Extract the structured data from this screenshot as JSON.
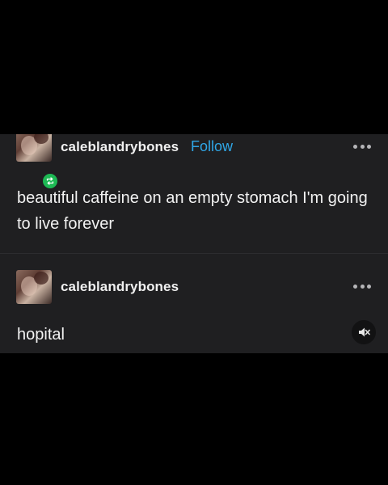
{
  "posts": [
    {
      "username": "caleblandrybones",
      "follow_label": "Follow",
      "text": "beautiful caffeine on an empty stomach I'm going to live forever"
    },
    {
      "username": "caleblandrybones",
      "text": "hopital"
    }
  ],
  "icons": {
    "more": "more-options-icon",
    "reblog": "reblog-icon",
    "mute": "muted-speaker-icon"
  },
  "colors": {
    "background": "#000000",
    "panel": "#1f1f21",
    "follow_link": "#2fa6e6",
    "reblog_badge": "#1db954"
  }
}
